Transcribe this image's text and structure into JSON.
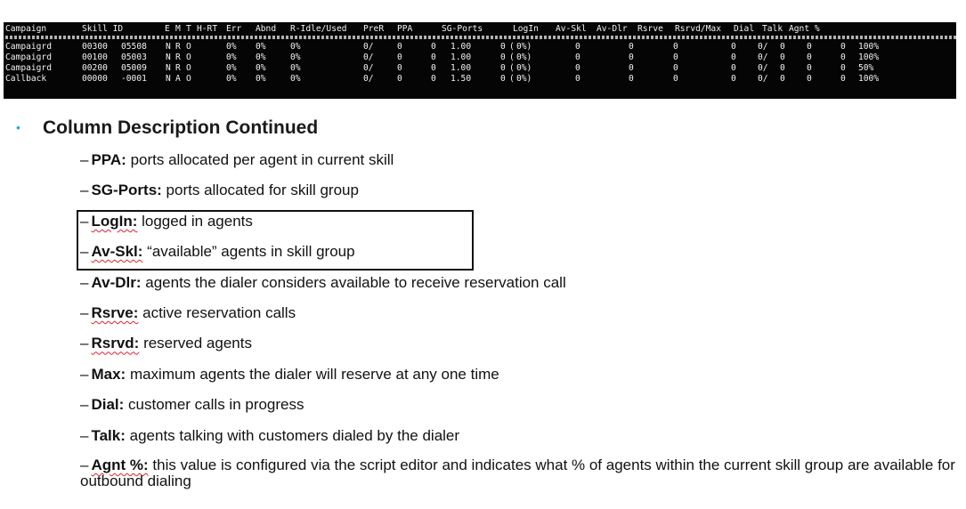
{
  "terminal": {
    "headers": [
      "Campaign",
      "Skill ID",
      "E",
      "M",
      "T",
      "H-RT",
      "Err",
      "Abnd",
      "R-Idle/Used",
      "PreR",
      "PPA",
      "SG-Ports",
      "LogIn",
      "Av-Skl",
      "Av-Dlr",
      "Rsrve",
      "Rsrvd/Max",
      "Dial",
      "Talk",
      "Agnt %"
    ],
    "rows": [
      [
        "Campaigrd",
        "00300",
        "05508",
        "N",
        "R",
        "O",
        "0%",
        "0%",
        "0%",
        "0/",
        "0",
        "0",
        "1.00",
        "0",
        "(",
        "0%)",
        "0",
        "0",
        "0",
        "0",
        "0/",
        "0",
        "0",
        "0",
        "100%"
      ],
      [
        "Campaigrd",
        "00100",
        "05003",
        "N",
        "R",
        "O",
        "0%",
        "0%",
        "0%",
        "0/",
        "0",
        "0",
        "1.00",
        "0",
        "(",
        "0%)",
        "0",
        "0",
        "0",
        "0",
        "0/",
        "0",
        "0",
        "0",
        "100%"
      ],
      [
        "Campaigrd",
        "00200",
        "05009",
        "N",
        "R",
        "O",
        "0%",
        "0%",
        "0%",
        "0/",
        "0",
        "0",
        "1.00",
        "0",
        "(",
        "0%)",
        "0",
        "0",
        "0",
        "0",
        "0/",
        "0",
        "0",
        "0",
        "50%"
      ],
      [
        "Callback",
        "00000",
        "-0001",
        "N",
        "A",
        "O",
        "0%",
        "0%",
        "0%",
        "0/",
        "0",
        "0",
        "1.50",
        "0",
        "(",
        "0%)",
        "0",
        "0",
        "0",
        "0",
        "0/",
        "0",
        "0",
        "0",
        "100%"
      ]
    ]
  },
  "heading": "Column Description Continued",
  "dash": "–",
  "items": [
    {
      "term": "PPA:",
      "desc": "ports allocated per agent in current skill",
      "underline": false
    },
    {
      "term": "SG-Ports:",
      "desc": "ports allocated for skill group",
      "underline": false
    },
    {
      "term": "LogIn:",
      "desc": "logged in agents",
      "underline": true
    },
    {
      "term": "Av-Skl:",
      "desc": "“available” agents in skill group",
      "underline": true
    },
    {
      "term": "Av-Dlr:",
      "desc": "agents the dialer considers available to receive reservation call",
      "underline": false
    },
    {
      "term": "Rsrve:",
      "desc": "active reservation calls",
      "underline": true
    },
    {
      "term": "Rsrvd:",
      "desc": "reserved agents",
      "underline": true
    },
    {
      "term": "Max:",
      "desc": "maximum agents the dialer will reserve at any one time",
      "underline": false
    },
    {
      "term": "Dial:",
      "desc": "customer calls in progress",
      "underline": false
    },
    {
      "term": "Talk:",
      "desc": "agents talking with customers dialed by the dialer",
      "underline": false
    },
    {
      "term": "Agnt %:",
      "desc": "this value is configured via the script editor and indicates what % of agents within the current skill group are available for outbound dialing",
      "underline": true
    }
  ]
}
